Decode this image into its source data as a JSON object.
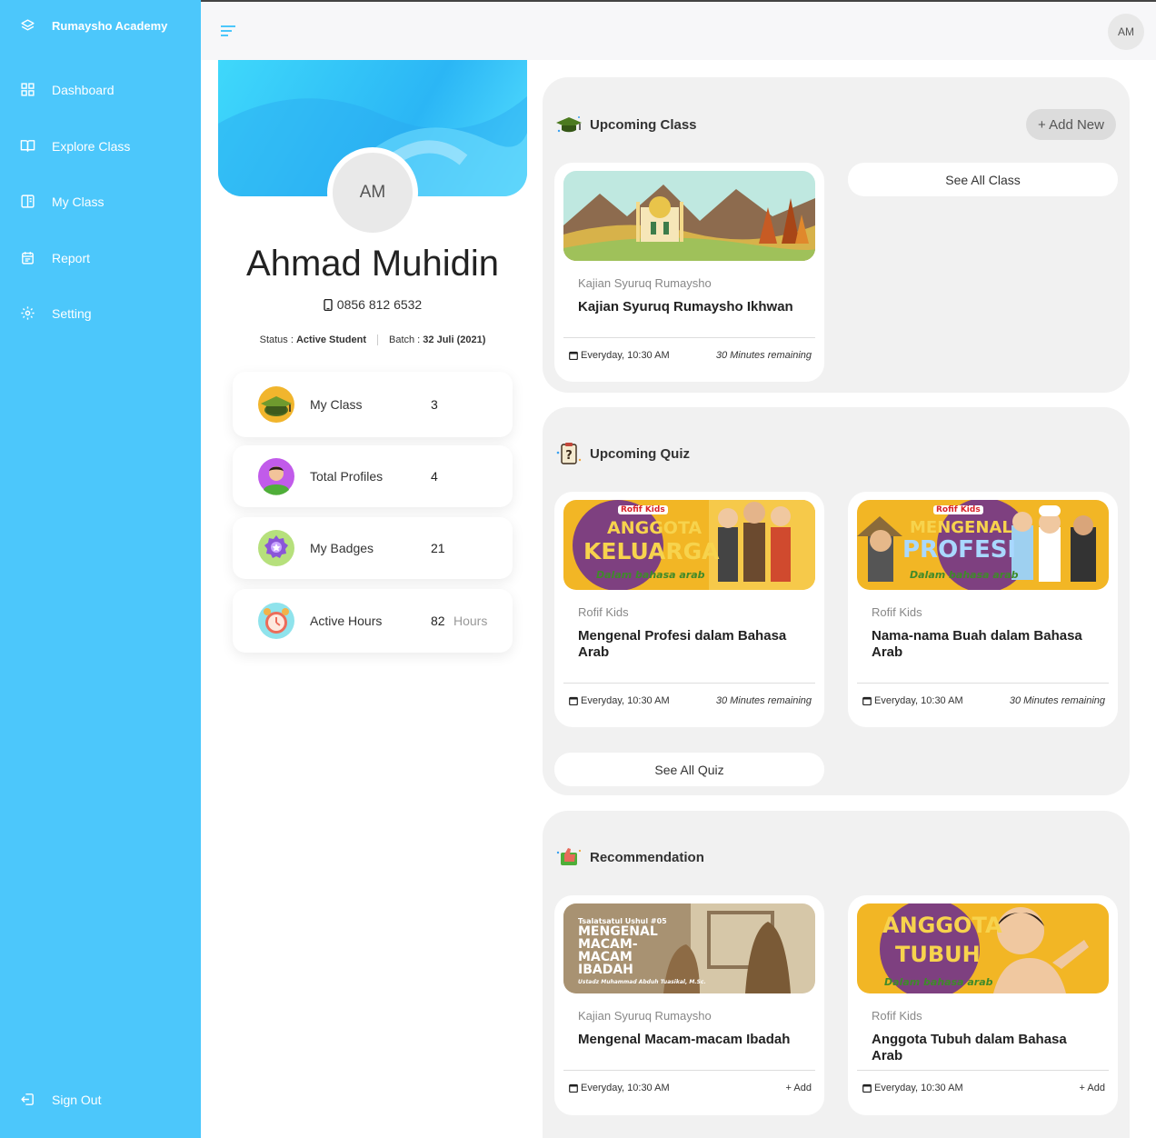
{
  "sidebar": {
    "brand": "Rumaysho Academy",
    "items": [
      {
        "label": "Dashboard",
        "icon": "grid-icon"
      },
      {
        "label": "Explore Class",
        "icon": "book-open-icon"
      },
      {
        "label": "My Class",
        "icon": "notebook-icon"
      },
      {
        "label": "Report",
        "icon": "calendar-report-icon"
      },
      {
        "label": "Setting",
        "icon": "gear-icon"
      }
    ],
    "signout": "Sign Out"
  },
  "topbar": {
    "avatar": "AM"
  },
  "profile": {
    "avatar": "AM",
    "name": "Ahmad Muhidin",
    "phone": "0856 812 6532",
    "status_label": "Status : ",
    "status_value": "Active Student",
    "batch_label": "Batch : ",
    "batch_value": "32 Juli (2021)"
  },
  "stats": [
    {
      "label": "My Class",
      "value": "3",
      "unit": ""
    },
    {
      "label": "Total Profiles",
      "value": "4",
      "unit": ""
    },
    {
      "label": "My Badges",
      "value": "21",
      "unit": ""
    },
    {
      "label": "Active Hours",
      "value": "82",
      "unit": "Hours"
    }
  ],
  "upcoming_class": {
    "title": "Upcoming Class",
    "add_new": "+ Add New",
    "see_all": "See All Class",
    "cards": [
      {
        "category": "Kajian Syuruq Rumaysho",
        "title": "Kajian Syuruq Rumaysho Ikhwan",
        "schedule": "Everyday, 10:30 AM",
        "meta": "30 Minutes remaining"
      }
    ]
  },
  "upcoming_quiz": {
    "title": "Upcoming Quiz",
    "see_all": "See All Quiz",
    "cards": [
      {
        "category": "Rofif Kids",
        "title": "Mengenal Profesi dalam Bahasa Arab",
        "schedule": "Everyday, 10:30 AM",
        "meta": "30 Minutes remaining",
        "thumb_brand": "Rofif Kids",
        "thumb_line1": "ANGGOTA",
        "thumb_line2": "KELUARGA",
        "thumb_sub": "Dalam bahasa arab"
      },
      {
        "category": "Rofif Kids",
        "title": "Nama-nama Buah dalam Bahasa Arab",
        "schedule": "Everyday, 10:30 AM",
        "meta": "30 Minutes remaining",
        "thumb_brand": "Rofif Kids",
        "thumb_line1": "MENGENAL",
        "thumb_line2": "PROFESI",
        "thumb_sub": "Dalam bahasa arab"
      }
    ]
  },
  "recommendation": {
    "title": "Recommendation",
    "cards": [
      {
        "category": "Kajian Syuruq Rumaysho",
        "title": "Mengenal Macam-macam Ibadah",
        "schedule": "Everyday, 10:30 AM",
        "meta": "+ Add",
        "thumb_kicker": "Tsalatsatul Ushul #05",
        "thumb_line1": "MENGENAL",
        "thumb_line2": "MACAM-",
        "thumb_line3": "MACAM",
        "thumb_line4": "IBADAH",
        "thumb_sub": "Ustadz Muhammad Abduh Tuasikal, M.Sc."
      },
      {
        "category": "Rofif Kids",
        "title": "Anggota Tubuh dalam Bahasa Arab",
        "schedule": "Everyday, 10:30 AM",
        "meta": "+ Add",
        "thumb_line1": "ANGGOTA",
        "thumb_line2": "TUBUH",
        "thumb_sub": "Dalam bahasa arab"
      }
    ]
  },
  "colors": {
    "sidebar": "#4cc7fb",
    "panel": "#f1f1f1",
    "accent": "#2bb6f5"
  }
}
